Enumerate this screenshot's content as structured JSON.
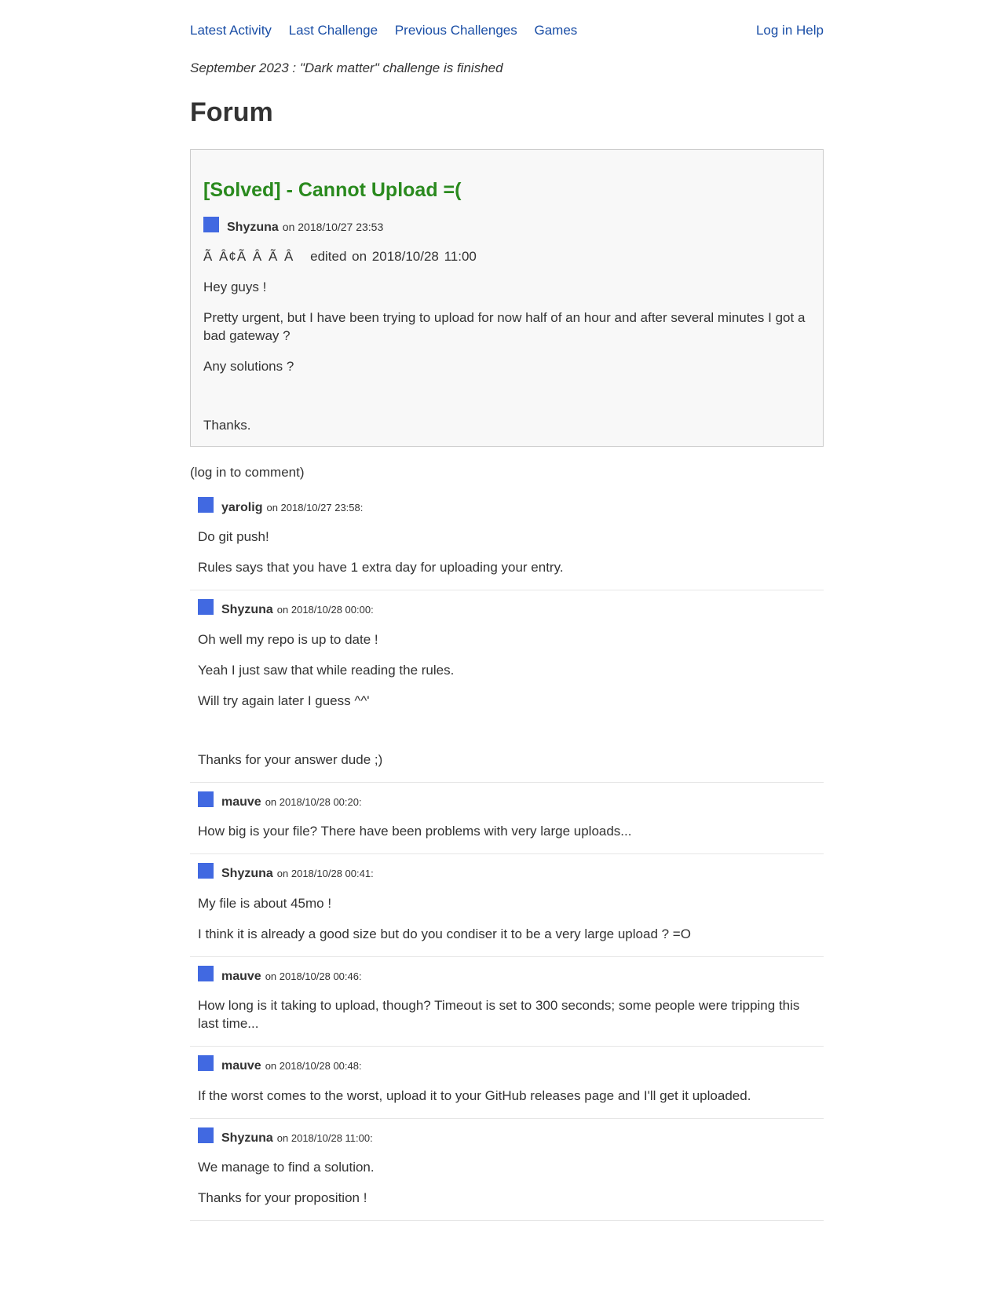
{
  "nav": {
    "latest_activity": "Latest Activity",
    "last_challenge": "Last Challenge",
    "previous_challenges": "Previous Challenges",
    "games": "Games",
    "log_in": "Log in",
    "help": "Help"
  },
  "announcement": "September 2023 : \"Dark matter\" challenge is finished",
  "page_title": "Forum",
  "thread": {
    "title": "[Solved] - Cannot Upload =(",
    "author": "Shyzuna",
    "posted": "on 2018/10/27 23:53",
    "mojibake": "Ã Â¢Ã Â Ã Â",
    "edited": "edited on 2018/10/28 11:00",
    "paragraphs": [
      "Hey guys !",
      "Pretty urgent, but I have been trying to upload for now half of an hour and after several minutes I got a bad gateway ?",
      "Any solutions ?",
      "Thanks."
    ]
  },
  "login_note": "(log in to comment)",
  "comments": [
    {
      "author": "yarolig",
      "posted": "on 2018/10/27 23:58:",
      "paragraphs": [
        "Do git push!",
        "Rules says that you have 1 extra day for uploading your entry."
      ]
    },
    {
      "author": "Shyzuna",
      "posted": "on 2018/10/28 00:00:",
      "paragraphs": [
        "Oh well my repo is up to date !",
        "Yeah I just saw that while reading the rules.",
        "Will try again later I guess ^^'",
        "Thanks for your answer dude ;)"
      ]
    },
    {
      "author": "mauve",
      "posted": "on 2018/10/28 00:20:",
      "paragraphs": [
        "How big is your file? There have been problems with very large uploads..."
      ]
    },
    {
      "author": "Shyzuna",
      "posted": "on 2018/10/28 00:41:",
      "paragraphs": [
        "My file is about 45mo !",
        "I think it is already a good size but do you condiser it to be a very large upload ? =O"
      ]
    },
    {
      "author": "mauve",
      "posted": "on 2018/10/28 00:46:",
      "paragraphs": [
        "How long is it taking to upload, though? Timeout is set to 300 seconds; some people were tripping this last time..."
      ]
    },
    {
      "author": "mauve",
      "posted": "on 2018/10/28 00:48:",
      "paragraphs": [
        "If the worst comes to the worst, upload it to your GitHub releases page and I'll get it uploaded."
      ]
    },
    {
      "author": "Shyzuna",
      "posted": "on 2018/10/28 11:00:",
      "paragraphs": [
        "We manage to find a solution.",
        "Thanks for your proposition !"
      ]
    }
  ]
}
